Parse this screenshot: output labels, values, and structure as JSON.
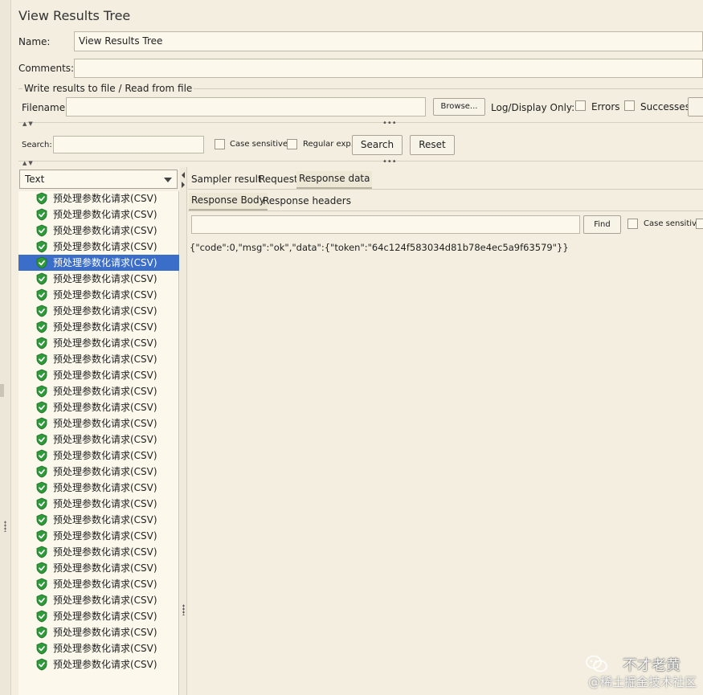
{
  "panel": {
    "title": "View Results Tree",
    "name_label": "Name:",
    "name_value": "View Results Tree",
    "comments_label": "Comments:",
    "comments_value": ""
  },
  "file_group": {
    "legend": "Write results to file / Read from file",
    "filename_label": "Filename",
    "filename_value": "",
    "browse_label": "Browse...",
    "log_display_label": "Log/Display Only:",
    "errors_label": "Errors",
    "successes_label": "Successes"
  },
  "search_bar": {
    "label": "Search:",
    "value": "",
    "case_sensitive_label": "Case sensitive",
    "regex_label": "Regular exp.",
    "search_button": "Search",
    "reset_button": "Reset"
  },
  "renderer": {
    "selected": "Text"
  },
  "results": {
    "items": [
      {
        "label": "预处理参数化请求(CSV)",
        "selected": false
      },
      {
        "label": "预处理参数化请求(CSV)",
        "selected": false
      },
      {
        "label": "预处理参数化请求(CSV)",
        "selected": false
      },
      {
        "label": "预处理参数化请求(CSV)",
        "selected": false
      },
      {
        "label": "预处理参数化请求(CSV)",
        "selected": true
      },
      {
        "label": "预处理参数化请求(CSV)",
        "selected": false
      },
      {
        "label": "预处理参数化请求(CSV)",
        "selected": false
      },
      {
        "label": "预处理参数化请求(CSV)",
        "selected": false
      },
      {
        "label": "预处理参数化请求(CSV)",
        "selected": false
      },
      {
        "label": "预处理参数化请求(CSV)",
        "selected": false
      },
      {
        "label": "预处理参数化请求(CSV)",
        "selected": false
      },
      {
        "label": "预处理参数化请求(CSV)",
        "selected": false
      },
      {
        "label": "预处理参数化请求(CSV)",
        "selected": false
      },
      {
        "label": "预处理参数化请求(CSV)",
        "selected": false
      },
      {
        "label": "预处理参数化请求(CSV)",
        "selected": false
      },
      {
        "label": "预处理参数化请求(CSV)",
        "selected": false
      },
      {
        "label": "预处理参数化请求(CSV)",
        "selected": false
      },
      {
        "label": "预处理参数化请求(CSV)",
        "selected": false
      },
      {
        "label": "预处理参数化请求(CSV)",
        "selected": false
      },
      {
        "label": "预处理参数化请求(CSV)",
        "selected": false
      },
      {
        "label": "预处理参数化请求(CSV)",
        "selected": false
      },
      {
        "label": "预处理参数化请求(CSV)",
        "selected": false
      },
      {
        "label": "预处理参数化请求(CSV)",
        "selected": false
      },
      {
        "label": "预处理参数化请求(CSV)",
        "selected": false
      },
      {
        "label": "预处理参数化请求(CSV)",
        "selected": false
      },
      {
        "label": "预处理参数化请求(CSV)",
        "selected": false
      },
      {
        "label": "预处理参数化请求(CSV)",
        "selected": false
      },
      {
        "label": "预处理参数化请求(CSV)",
        "selected": false
      },
      {
        "label": "预处理参数化请求(CSV)",
        "selected": false
      },
      {
        "label": "预处理参数化请求(CSV)",
        "selected": false
      }
    ],
    "icon": "success-shield-icon",
    "colors": {
      "selected_bg": "#3a6ec8",
      "success_icon": "#2e9a3a"
    }
  },
  "tabs": {
    "main": [
      "Sampler result",
      "Request",
      "Response data"
    ],
    "main_active": "Response data",
    "sub": [
      "Response Body",
      "Response headers"
    ],
    "sub_active": "Response Body"
  },
  "find_bar": {
    "value": "",
    "find_button": "Find",
    "case_sensitive_label": "Case sensitive"
  },
  "response_body": "{\"code\":0,\"msg\":\"ok\",\"data\":{\"token\":\"64c124f583034d81b78e4ec5a9f63579\"}}",
  "watermark": {
    "line1": "不才老黄",
    "line2": "@稀土掘金技术社区"
  }
}
